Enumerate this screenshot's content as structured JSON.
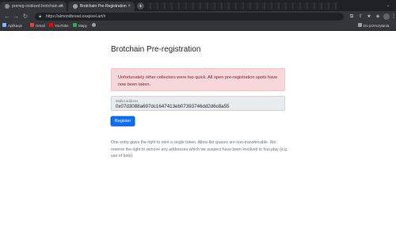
{
  "browser": {
    "tabs": [
      {
        "title": "preneg-oxidized.brotchain.art",
        "active": false
      },
      {
        "title": "Brotchain Pre-Registration",
        "active": true
      }
    ],
    "new_tab_symbol": "+",
    "url": "https://almondbread.exapixel.art/#",
    "bookmarks": [
      {
        "label": "Aplikacje",
        "color": "#8ab4f8"
      },
      {
        "label": "Gmail",
        "color": "#ea4335"
      },
      {
        "label": "YouTube",
        "color": "#ff0000"
      },
      {
        "label": "Mapy",
        "color": "#34a853"
      }
    ],
    "other_bookmarks": "Do przeczytania",
    "window_colors": [
      "#ff5f57",
      "#febc2e",
      "#28c840"
    ]
  },
  "page": {
    "title": "Brotchain Pre-registration",
    "alert": "Unfortunately other collectors were too quick. All open pre-registration spots have now been taken.",
    "wallet": {
      "label": "Wallet address",
      "value": "0x07d3088a697dc1647413eb07393746dd2d6c8a55"
    },
    "register_label": "Register",
    "footnote": "One entry gives the right to mint a single token. Allow-list spaces are non-transferrable. We reserve the right to remove any addresses which we suspect have been involved in foul play (e.g. use of bots)."
  },
  "colors": {
    "alert_bg": "#f8d7da",
    "alert_text": "#842029",
    "primary": "#0d6efd"
  }
}
